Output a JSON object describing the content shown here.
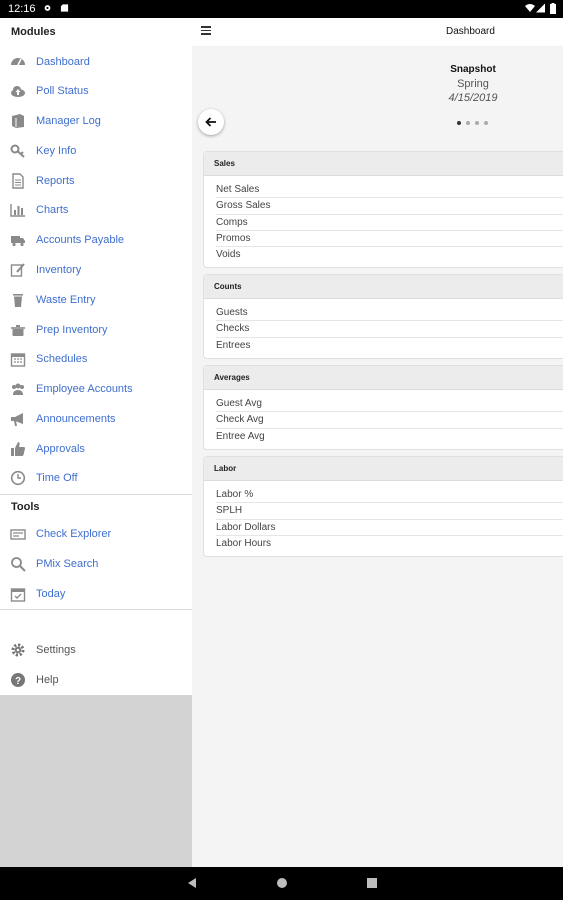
{
  "status_bar": {
    "time": "12:16"
  },
  "topbar": {
    "title": "Dashboard"
  },
  "sidebar": {
    "modules_title": "Modules",
    "modules": [
      {
        "label": "Dashboard",
        "icon": "tachometer-icon"
      },
      {
        "label": "Poll Status",
        "icon": "cloud-upload-icon"
      },
      {
        "label": "Manager Log",
        "icon": "book-icon"
      },
      {
        "label": "Key Info",
        "icon": "key-icon"
      },
      {
        "label": "Reports",
        "icon": "file-text-icon"
      },
      {
        "label": "Charts",
        "icon": "bar-chart-icon"
      },
      {
        "label": "Accounts Payable",
        "icon": "truck-icon"
      },
      {
        "label": "Inventory",
        "icon": "edit-icon"
      },
      {
        "label": "Waste Entry",
        "icon": "trash-icon"
      },
      {
        "label": "Prep Inventory",
        "icon": "cooking-pot-icon"
      },
      {
        "label": "Schedules",
        "icon": "calendar-icon"
      },
      {
        "label": "Employee Accounts",
        "icon": "users-icon"
      },
      {
        "label": "Announcements",
        "icon": "bullhorn-icon"
      },
      {
        "label": "Approvals",
        "icon": "thumbs-up-icon"
      },
      {
        "label": "Time Off",
        "icon": "clock-icon"
      }
    ],
    "tools_title": "Tools",
    "tools": [
      {
        "label": "Check Explorer",
        "icon": "receipt-icon"
      },
      {
        "label": "PMix Search",
        "icon": "search-icon"
      },
      {
        "label": "Today",
        "icon": "calendar-check-icon"
      }
    ],
    "footer": [
      {
        "label": "Settings",
        "icon": "gear-icon"
      },
      {
        "label": "Help",
        "icon": "question-circle-icon"
      }
    ]
  },
  "snapshot": {
    "title": "Snapshot",
    "season": "Spring",
    "date": "4/15/2019",
    "page_count": 4,
    "active_page": 1
  },
  "cards": [
    {
      "title": "Sales",
      "rows": [
        "Net Sales",
        "Gross Sales",
        "Comps",
        "Promos",
        "Voids"
      ]
    },
    {
      "title": "Counts",
      "rows": [
        "Guests",
        "Checks",
        "Entrees"
      ]
    },
    {
      "title": "Averages",
      "rows": [
        "Guest Avg",
        "Check Avg",
        "Entree Avg"
      ]
    },
    {
      "title": "Labor",
      "rows": [
        "Labor %",
        "SPLH",
        "Labor Dollars",
        "Labor Hours"
      ]
    }
  ],
  "colors": {
    "link": "#3f6fcf",
    "icon": "#8a8a8a",
    "sidebar_bg": "#ffffff",
    "main_bg": "#f4f4f4"
  }
}
